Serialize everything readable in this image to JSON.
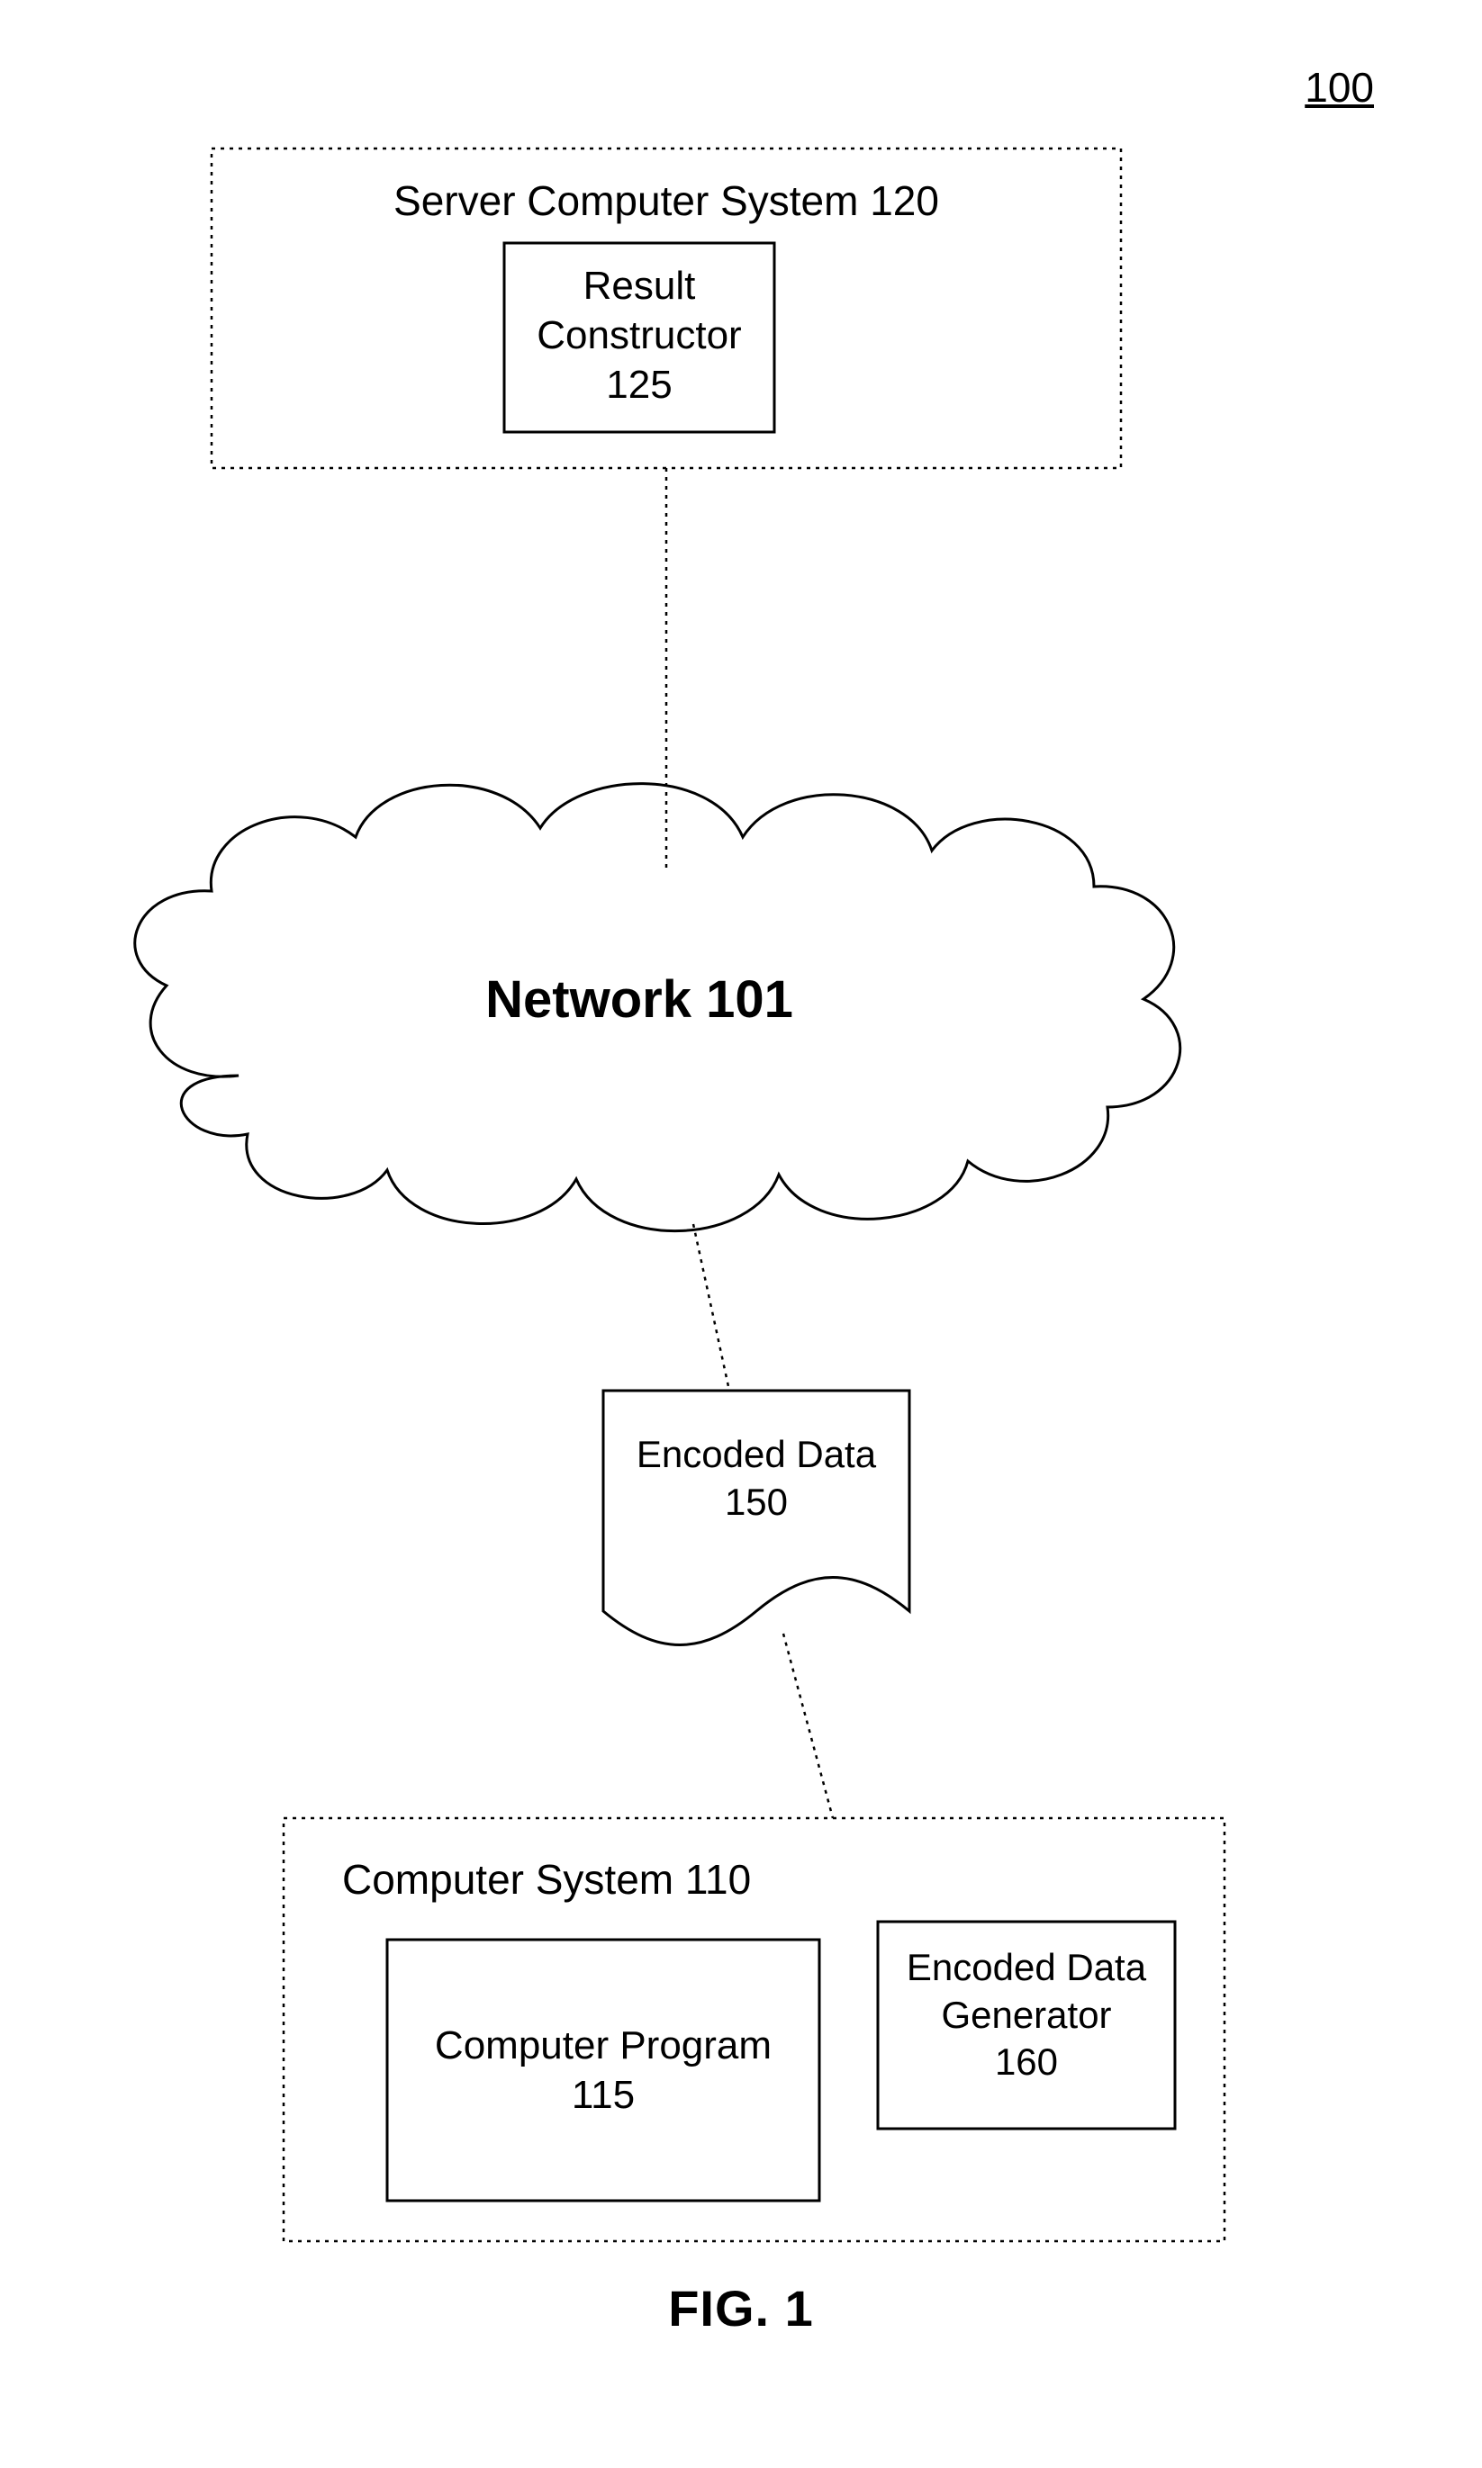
{
  "figure": {
    "reference_number": "100",
    "caption": "FIG. 1"
  },
  "server": {
    "label_line1": "Server Computer System 120",
    "result_constructor_line1": "Result",
    "result_constructor_line2": "Constructor",
    "result_constructor_line3": "125"
  },
  "network": {
    "label": "Network 101"
  },
  "encoded_data": {
    "line1": "Encoded Data",
    "line2": "150"
  },
  "client": {
    "label_line1": "Computer System 110",
    "program_line1": "Computer Program",
    "program_line2": "115",
    "generator_line1": "Encoded Data",
    "generator_line2": "Generator",
    "generator_line3": "160"
  }
}
